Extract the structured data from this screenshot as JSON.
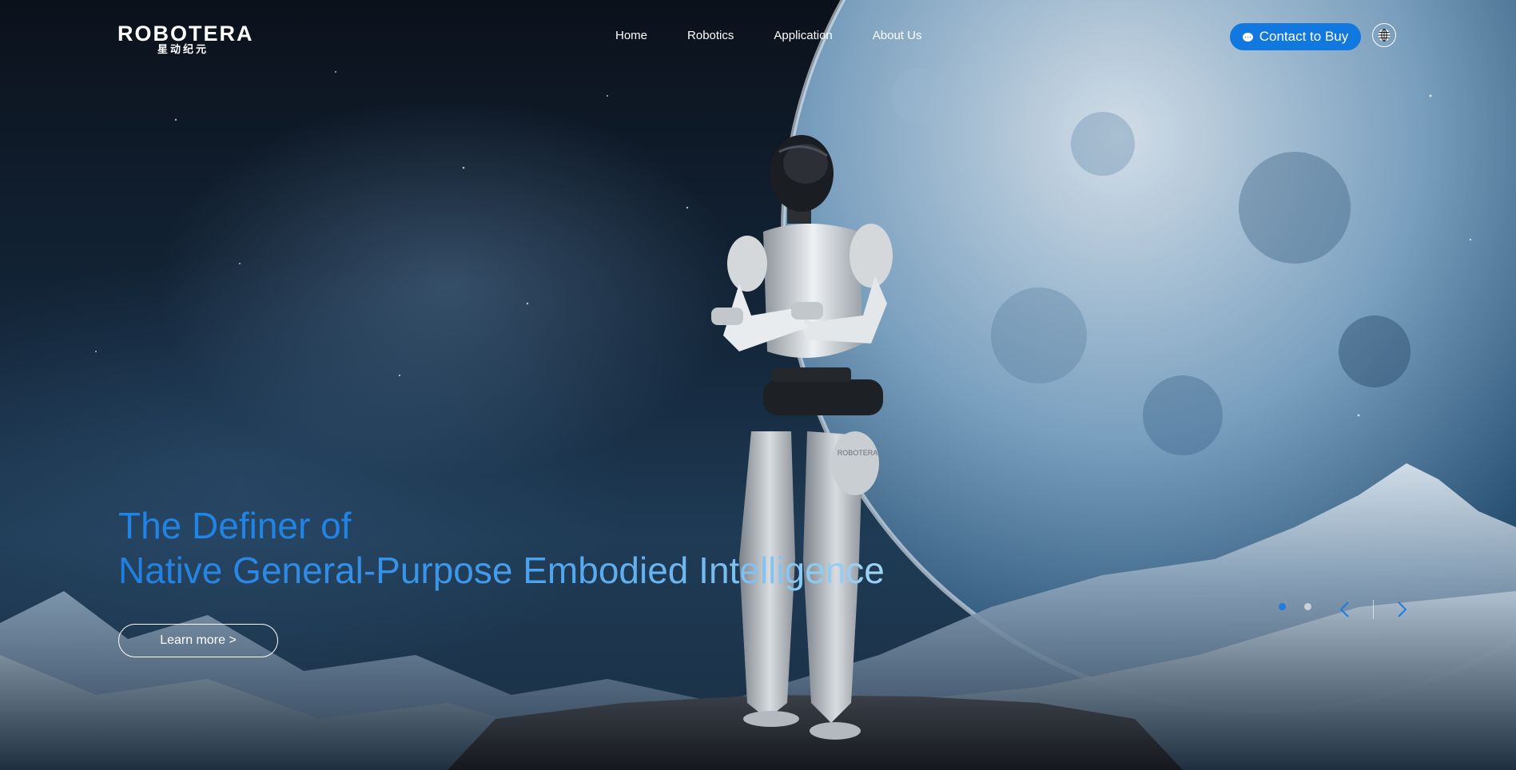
{
  "brand": {
    "name": "ROBOTERA",
    "name_cn": "星动纪元"
  },
  "nav": {
    "items": [
      {
        "label": "Home"
      },
      {
        "label": "Robotics"
      },
      {
        "label": "Application"
      },
      {
        "label": "About Us"
      }
    ]
  },
  "header": {
    "contact_label": "Contact to Buy",
    "contact_icon": "chat-bubble-icon",
    "language_icon": "globe-icon"
  },
  "hero": {
    "title_line1": "The Definer of",
    "title_line2": "Native General-Purpose Embodied Intelligence",
    "cta_label": "Learn more >",
    "robot_badge": "ROBOTERA"
  },
  "carousel": {
    "slides_total": 2,
    "active_slide": 1,
    "prev_icon": "chevron-left-icon",
    "next_icon": "chevron-right-icon"
  },
  "colors": {
    "accent": "#1178e0",
    "title_blue": "#2184e4",
    "title_light": "#9fd4f4",
    "dot_active": "#1e7be0",
    "dot_inactive": "#c8d0d8"
  }
}
